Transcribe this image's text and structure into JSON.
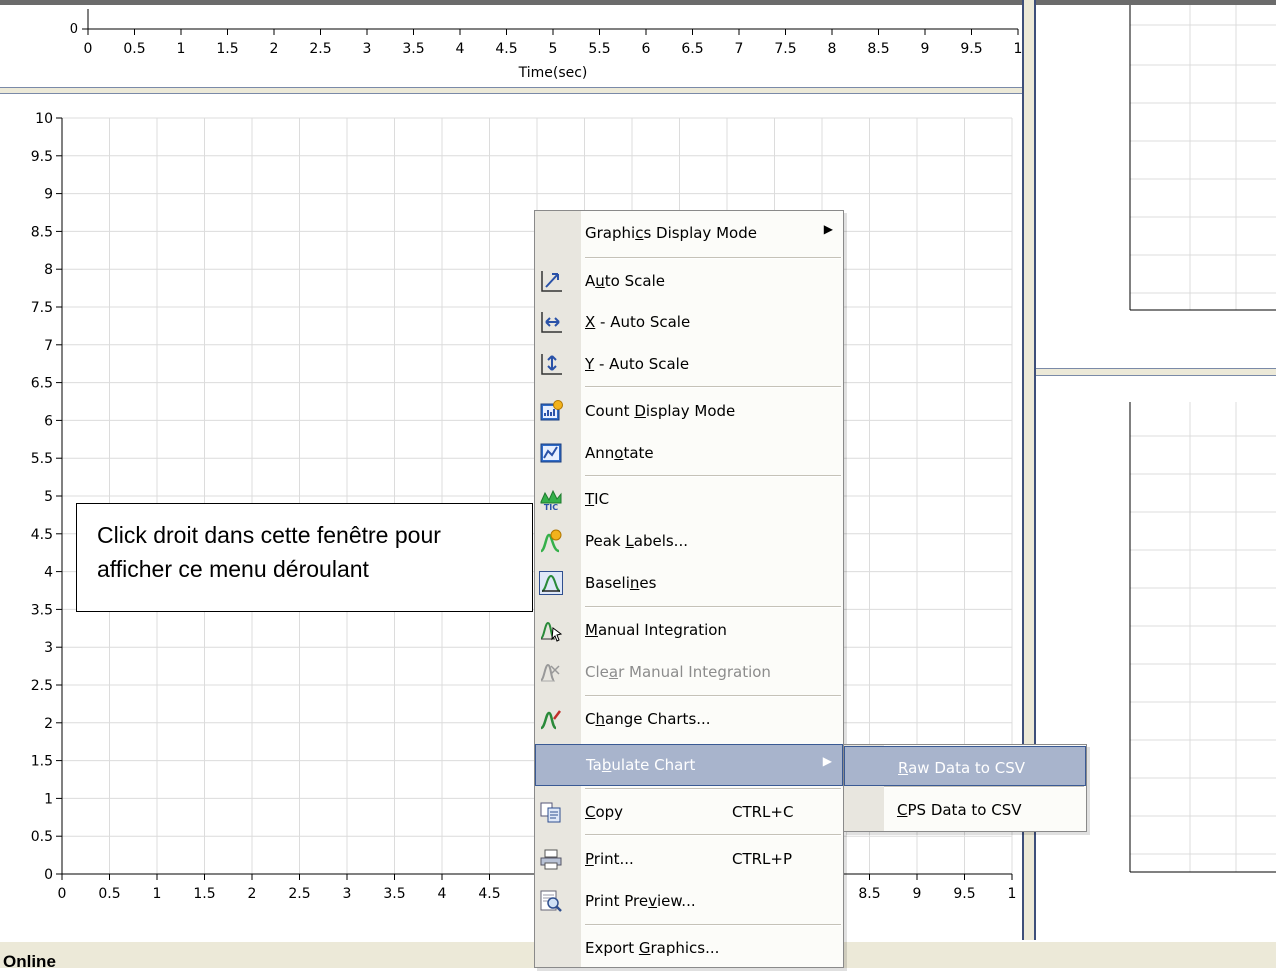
{
  "top_chart": {
    "y_tick": "0",
    "x_ticks": [
      "0",
      "0.5",
      "1",
      "1.5",
      "2",
      "2.5",
      "3",
      "3.5",
      "4",
      "4.5",
      "5",
      "5.5",
      "6",
      "6.5",
      "7",
      "7.5",
      "8",
      "8.5",
      "9",
      "9.5",
      "1"
    ],
    "x_label": "Time(sec)"
  },
  "main_chart": {
    "y_ticks": [
      "10",
      "9.5",
      "9",
      "8.5",
      "8",
      "7.5",
      "7",
      "6.5",
      "6",
      "5.5",
      "5",
      "4.5",
      "4",
      "3.5",
      "3",
      "2.5",
      "2",
      "1.5",
      "1",
      "0.5",
      "0"
    ],
    "x_ticks_left": [
      "0",
      "0.5",
      "1",
      "1.5",
      "2",
      "2.5",
      "3",
      "3.5",
      "4",
      "4.5"
    ],
    "x_ticks_right": [
      "8.5",
      "9",
      "9.5",
      "1"
    ]
  },
  "callout": {
    "line1": "Click droit dans cette fenêtre pour",
    "line2": "afficher ce menu déroulant"
  },
  "status_bar": {
    "text": "Online"
  },
  "context_menu": {
    "items": [
      {
        "pre": "Graphi",
        "key": "c",
        "post": "s Display Mode",
        "icon": "none",
        "submenu": true
      },
      {
        "pre": "A",
        "key": "u",
        "post": "to Scale",
        "icon": "auto-scale-icon"
      },
      {
        "pre": "",
        "key": "X",
        "post": " - Auto Scale",
        "icon": "x-auto-scale-icon"
      },
      {
        "pre": "",
        "key": "Y",
        "post": " - Auto Scale",
        "icon": "y-auto-scale-icon"
      },
      {
        "pre": "Count ",
        "key": "D",
        "post": "isplay Mode",
        "icon": "count-display-icon"
      },
      {
        "pre": "Ann",
        "key": "o",
        "post": "tate",
        "icon": "annotate-icon"
      },
      {
        "pre": "",
        "key": "T",
        "post": "IC",
        "icon": "tic-icon"
      },
      {
        "pre": "Peak ",
        "key": "L",
        "post": "abels...",
        "icon": "peak-labels-icon"
      },
      {
        "pre": "Baseli",
        "key": "n",
        "post": "es",
        "icon": "baselines-icon"
      },
      {
        "pre": "",
        "key": "M",
        "post": "anual Integration",
        "icon": "manual-integration-icon"
      },
      {
        "pre": "Cle",
        "key": "a",
        "post": "r Manual Integration",
        "icon": "clear-manual-integration-icon",
        "disabled": true
      },
      {
        "pre": "C",
        "key": "h",
        "post": "ange Charts...",
        "icon": "change-charts-icon"
      },
      {
        "pre": "Ta",
        "key": "b",
        "post": "ulate Chart",
        "icon": "none",
        "submenu": true,
        "highlighted": true
      },
      {
        "pre": "",
        "key": "C",
        "post": "opy",
        "shortcut": "CTRL+C",
        "icon": "copy-icon"
      },
      {
        "pre": "",
        "key": "P",
        "post": "rint...",
        "shortcut": "CTRL+P",
        "icon": "print-icon"
      },
      {
        "pre": "Print Pre",
        "key": "v",
        "post": "iew...",
        "icon": "print-preview-icon"
      },
      {
        "pre": "Export ",
        "key": "G",
        "post": "raphics...",
        "icon": "none"
      }
    ]
  },
  "submenu": {
    "items": [
      {
        "pre": "",
        "key": "R",
        "post": "aw Data to CSV",
        "highlighted": true
      },
      {
        "pre": "",
        "key": "C",
        "post": "PS Data to CSV"
      }
    ]
  }
}
